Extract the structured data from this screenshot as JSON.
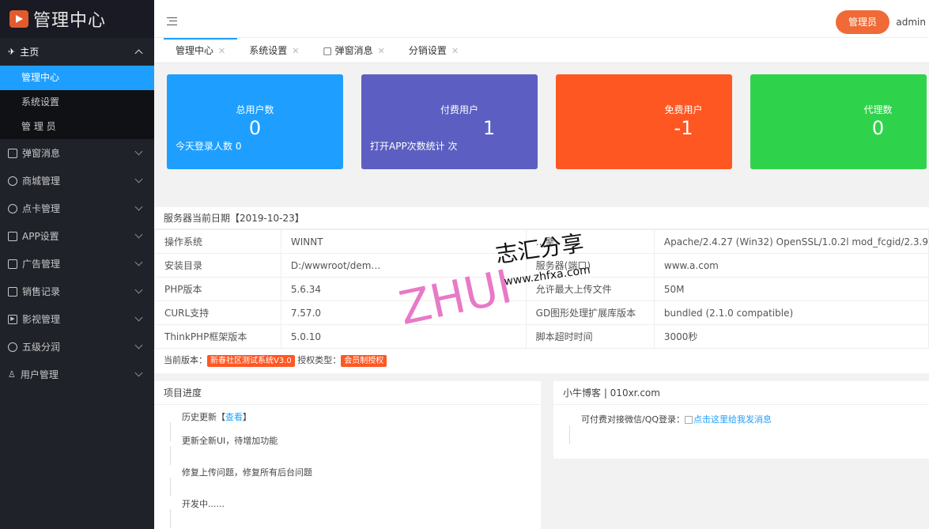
{
  "app": {
    "logo_text": "管理中心"
  },
  "sidebar": {
    "main_label": "主页",
    "sub_items": [
      "管理中心",
      "系统设置",
      "管 理 员"
    ],
    "items": [
      {
        "label": "弹窗消息",
        "icon": "phone-icon"
      },
      {
        "label": "商城管理",
        "icon": "cube-icon"
      },
      {
        "label": "点卡管理",
        "icon": "cube-icon"
      },
      {
        "label": "APP设置",
        "icon": "phone-icon"
      },
      {
        "label": "广告管理",
        "icon": "phone-icon"
      },
      {
        "label": "销售记录",
        "icon": "phone-icon"
      },
      {
        "label": "影视管理",
        "icon": "play-icon"
      },
      {
        "label": "五级分润",
        "icon": "cube-icon"
      },
      {
        "label": "用户管理",
        "icon": "user-icon"
      }
    ]
  },
  "header": {
    "role_badge": "管理员",
    "username": "admin"
  },
  "tabs": [
    {
      "label": "管理中心"
    },
    {
      "label": "系统设置"
    },
    {
      "label": "□ 弹窗消息"
    },
    {
      "label": "分销设置"
    }
  ],
  "cards": [
    {
      "title": "总用户数",
      "value": "0",
      "sub": "今天登录人数 0",
      "color": "#1e9fff"
    },
    {
      "title": "付费用户",
      "value": "1",
      "sub": "打开APP次数统计 次",
      "color": "#5c5fc1"
    },
    {
      "title": "免费用户",
      "value": "-1",
      "sub": "",
      "color": "#ff5722"
    },
    {
      "title": "代理数",
      "value": "0",
      "sub": "",
      "color": "#2fd34b"
    }
  ],
  "server": {
    "title": "服务器当前日期【2019-10-23】",
    "rows": [
      [
        "操作系统",
        "WINNT",
        "…擎",
        "Apache/2.4.27 (Win32) OpenSSL/1.0.2l mod_fcgid/2.3.9"
      ],
      [
        "安装目录",
        "D:/wwwroot/dem…",
        "服务器(端口)",
        "www.a.com"
      ],
      [
        "PHP版本",
        "5.6.34",
        "允许最大上传文件",
        "50M"
      ],
      [
        "CURL支持",
        "7.57.0",
        "GD图形处理扩展库版本",
        "bundled (2.1.0 compatible)"
      ],
      [
        "ThinkPHP框架版本",
        "5.0.10",
        "脚本超时时间",
        "3000秒"
      ]
    ],
    "version_label": "当前版本：",
    "version_value": "新春社区测试系统V3.0",
    "license_label": "授权类型：",
    "license_value": "会员制授权"
  },
  "progress": {
    "title": "项目进度",
    "history_label": "历史更新【",
    "history_link": "查看",
    "history_end": "】",
    "items": [
      "更新全新UI，待增加功能",
      "修复上传问题，修复所有后台问题",
      "开发中......"
    ]
  },
  "blog": {
    "title": "小牛博客 | 010xr.com",
    "text": "可付费对接微信/QQ登录：",
    "link": "点击这里给我发消息"
  },
  "watermark": {
    "brand": "ZHUI",
    "cn": "志汇分享",
    "url": "www.zhfxa.com"
  }
}
